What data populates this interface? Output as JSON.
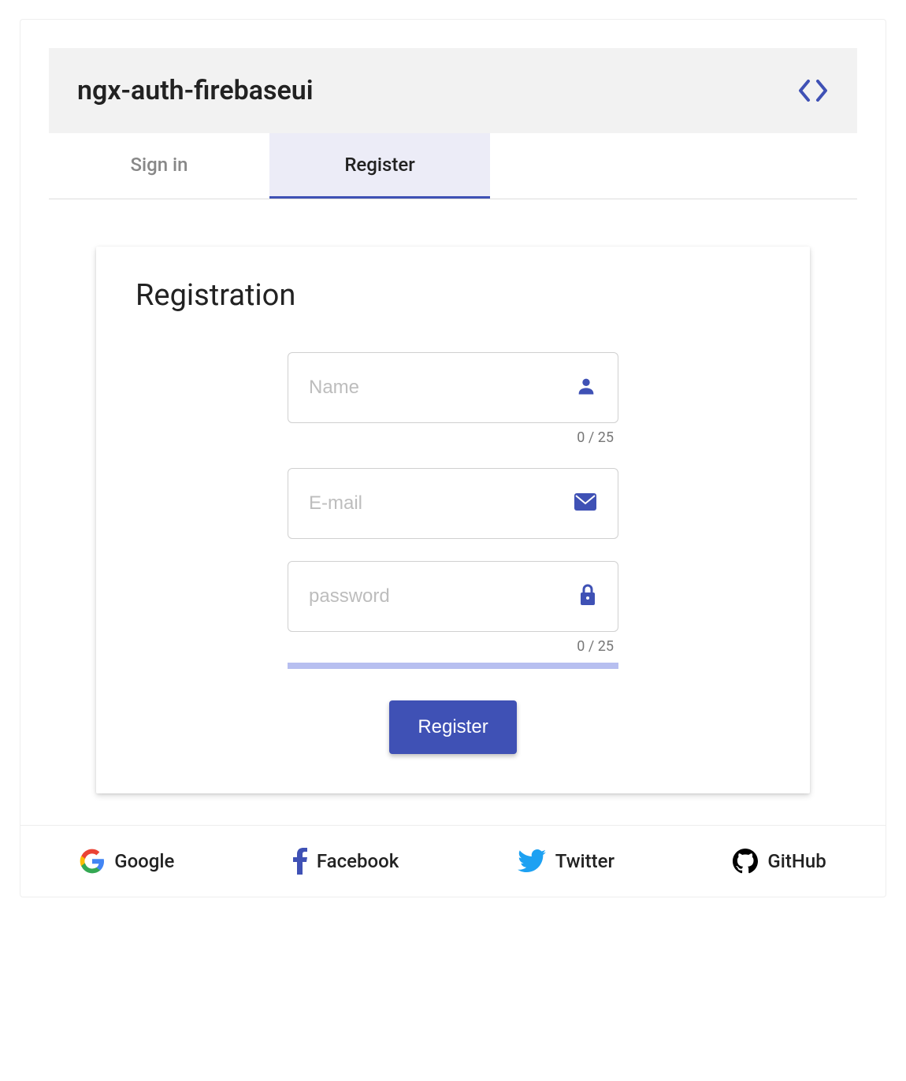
{
  "header": {
    "title": "ngx-auth-firebaseui"
  },
  "tabs": {
    "signin_label": "Sign in",
    "register_label": "Register",
    "active": "register"
  },
  "card": {
    "title": "Registration",
    "name_placeholder": "Name",
    "name_hint": "0 / 25",
    "email_placeholder": "E-mail",
    "password_placeholder": "password",
    "password_hint": "0 / 25",
    "submit_label": "Register"
  },
  "providers": {
    "google": "Google",
    "facebook": "Facebook",
    "twitter": "Twitter",
    "github": "GitHub"
  },
  "colors": {
    "primary": "#3f51b5"
  }
}
